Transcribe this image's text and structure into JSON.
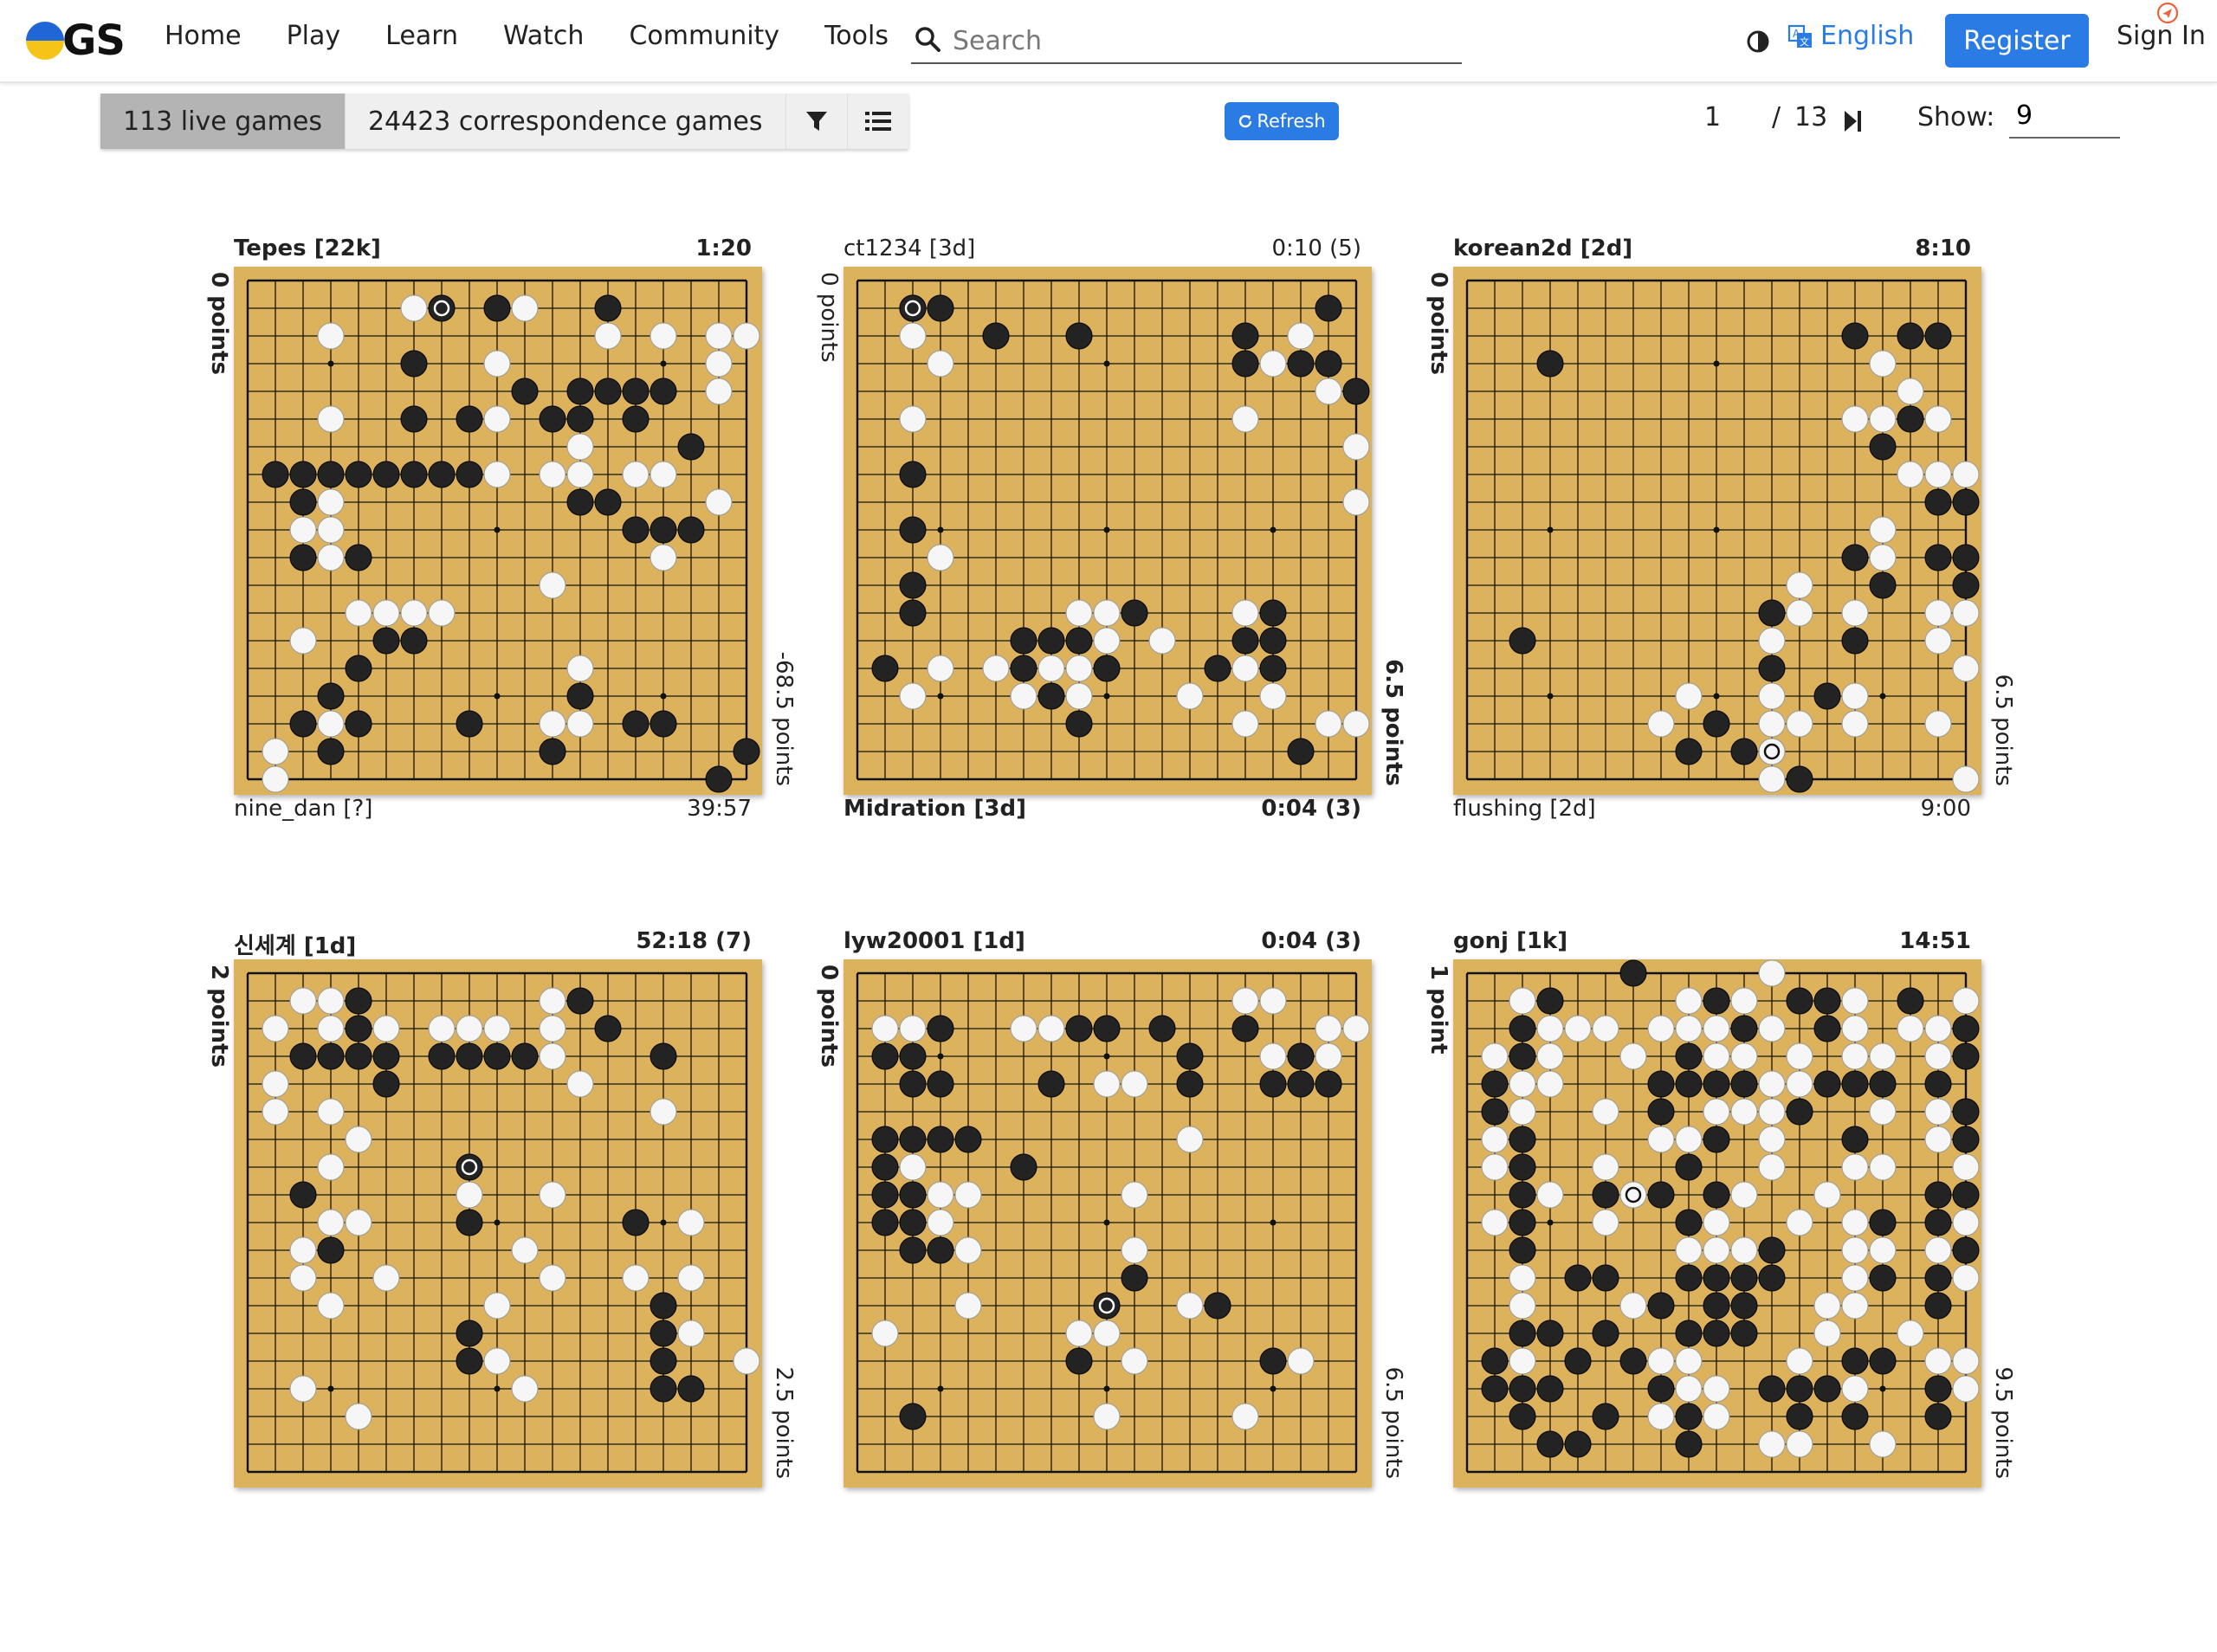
{
  "nav": {
    "logo_text": "GS",
    "links": [
      "Home",
      "Play",
      "Learn",
      "Watch",
      "Community",
      "Tools"
    ],
    "search_placeholder": "Search",
    "language": "English",
    "register": "Register",
    "sign_in": "Sign In"
  },
  "toolbar": {
    "live_games": "113 live games",
    "correspondence_games": "24423 correspondence games",
    "refresh": "Refresh",
    "page_current": "1",
    "page_total": "13",
    "page_sep": "/",
    "show_label": "Show:",
    "show_value": "9"
  },
  "games": [
    {
      "top": {
        "name": "Tepes  [22k]",
        "clock": "1:20",
        "bold": true
      },
      "bottom": {
        "name": "nine_dan  [?]",
        "clock": "39:57",
        "bold": false
      },
      "left_score": "0 points",
      "left_bold": true,
      "right_score": "-68.5 points",
      "right_bold": false,
      "last_move": [
        7,
        1
      ],
      "board": [
        "...................",
        "......W..BW..B.....",
        "...W.........W.W.WW",
        "......B..W.......W.",
        "..........B.BBBB.W.",
        "...W..B.BW.BB.B....",
        "............W...B..",
        ".BBBBBBBBW.WW.WW...",
        "..BW........BB...W.",
        "..WW..........BBB..",
        "..BWB..........W...",
        "...........W.......",
        "....WWWW...........",
        "..W..BB............",
        "....B.......W......",
        "...B........B......",
        "..BWB...B..WW.BB...",
        ".W.B.......B......B",
        ".W...............B."
      ]
    },
    {
      "top": {
        "name": "ct1234  [3d]",
        "clock": "0:10  (5)",
        "bold": false
      },
      "bottom": {
        "name": "Midration  [3d]",
        "clock": "0:04  (3)",
        "bold": true
      },
      "left_score": "0 points",
      "left_bold": false,
      "right_score": "6.5 points",
      "right_bold": true,
      "last_move": [
        2,
        1
      ],
      "board": [
        "...................",
        "..BB.............B.",
        "..W..B..B.....B.W..",
        "...W..........BWBB.",
        ".................WB",
        "..W...........W....",
        "..................W",
        "..B................",
        "..................W",
        "..B................",
        "...W...............",
        "..B................",
        "..B.....WWB...WB...",
        "......BBBW.W..BB...",
        ".B.W.WBWWB...BWB...",
        "..W...WBW...W..W...",
        "........B.....W..WW",
        "................B..",
        "..................."
      ]
    },
    {
      "top": {
        "name": "korean2d  [2d]",
        "clock": "8:10",
        "bold": true
      },
      "bottom": {
        "name": "flushing  [2d]",
        "clock": "9:00",
        "bold": false
      },
      "left_score": "0 points",
      "left_bold": true,
      "right_score": "6.5 points",
      "right_bold": false,
      "last_move": [
        11,
        17
      ],
      "board": [
        "...................",
        "...................",
        "..............B.BB.",
        "...B...........W...",
        "................W..",
        "..............WWBW.",
        "...............B...",
        "................WWW",
        ".................BB",
        "...............W...",
        "..............BW.BB",
        "............W..B..B",
        "...........BW.W..WW",
        "..B........W..B..W.",
        "...........B......W",
        "........W..W.BW....",
        ".......W.B.WW.W..W.",
        "........B.BW.......",
        "...........WB.....W"
      ]
    },
    {
      "top": {
        "name": "신세계  [1d]",
        "clock": "52:18  (7)",
        "bold": true
      },
      "bottom": {
        "name": "",
        "clock": "",
        "bold": false
      },
      "left_score": "2 points",
      "left_bold": true,
      "right_score": "2.5 points",
      "right_bold": false,
      "last_move": [
        8,
        7
      ],
      "board": [
        "...................",
        "..WWB......WB......",
        ".W.WBW.WWW.W.B.....",
        "..BBBB.BBBBW...B...",
        ".W...B......W......",
        ".W.W...........W...",
        "....W...............",
        "...W...............",
        "..B.....W..W.......",
        "...WW...B.....B.W..",
        "..WB......W........",
        "..W..W.....W..W.W..",
        "...W.....W.....B...",
        "........B......BW..",
        "........BW.....B..W",
        "..W.......W....BB..",
        "....W..............",
        "...................",
        "..................."
      ]
    },
    {
      "top": {
        "name": "lyw20001  [1d]",
        "clock": "0:04  (3)",
        "bold": true
      },
      "bottom": {
        "name": "",
        "clock": "",
        "bold": false
      },
      "left_score": "0 points",
      "left_bold": true,
      "right_score": "6.5 points",
      "right_bold": false,
      "last_move": [
        9,
        12
      ],
      "board": [
        "...................",
        "..............WW...",
        ".WWB..WWBB.B..B..WW",
        ".BB.........B..WBW..",
        "..BB...B.WW.B..BBB.",
        "...................",
        ".BBBB.......W......",
        ".BW...B............",
        ".BBWW.....W........",
        ".BBW...............",
        "..BBW.....W........",
        "..........B........",
        "....W.......WB.....",
        ".W......WW.........",
        "........B.W....BW..",
        "...................",
        "..B......W....W....",
        "...................",
        "..................."
      ]
    },
    {
      "top": {
        "name": "gonj  [1k]",
        "clock": "14:51",
        "bold": true
      },
      "bottom": {
        "name": "",
        "clock": "",
        "bold": false
      },
      "left_score": "1 point",
      "left_bold": true,
      "right_score": "9.5 points",
      "right_bold": false,
      "last_move": [
        6,
        8
      ],
      "board": [
        "......B....W.......",
        "..WB....WBW.BBW.B.W",
        "..BWWW.WWWBW.BW.WWB",
        ".WBW..W.BWW.W.WW.WB",
        ".BWW...BBBBWWBBB.B.",
        ".BW..W.B.WWWB..W.WB",
        ".WB....WWB.W..B..WB",
        ".WB..W..B..W..WW..W",
        "..BW.BWB.BW..W...BB",
        ".WB..W..BW..W.WB.BW",
        "..B.....WWWB..WW.WB",
        "..W.BB..BBBB..WB.BW",
        "..W...WB.BB..WW..B.",
        "..BB.B..BBB..W..W..",
        ".BW.B.BWW...W.BB.WW",
        ".BBB...BWW.BBBW..BW",
        "..B..B.WBW..B.B..B.",
        "...BB...B..WW..W...",
        "..................."
      ]
    }
  ]
}
